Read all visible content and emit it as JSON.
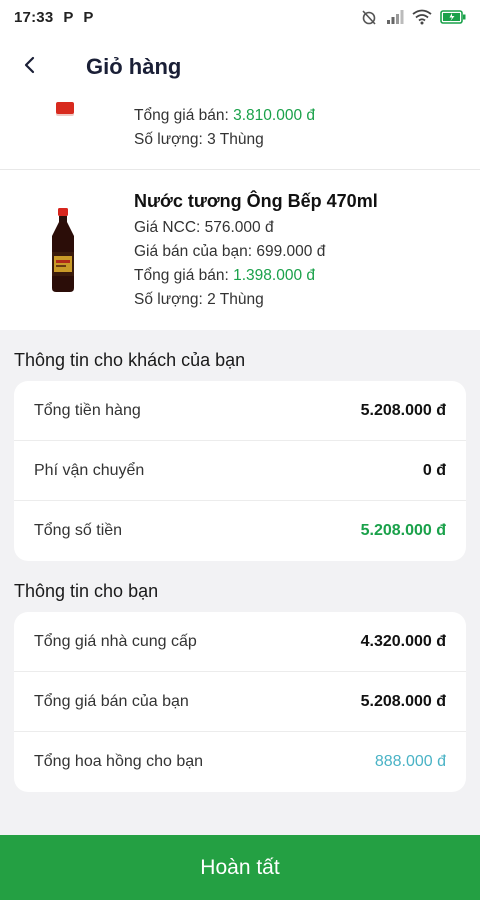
{
  "status_bar": {
    "time": "17:33",
    "app_icons": [
      "P",
      "P"
    ]
  },
  "header": {
    "title": "Giỏ hàng"
  },
  "products": [
    {
      "total_label": "Tổng giá bán: ",
      "total_value": "3.810.000 đ",
      "quantity": "Số lượng: 3 Thùng"
    },
    {
      "name": "Nước tương Ông Bếp 470ml",
      "supplier_price": "Giá NCC: 576.000 đ",
      "your_price": "Giá bán của bạn: 699.000 đ",
      "total_label": "Tổng giá bán: ",
      "total_value": "1.398.000 đ",
      "quantity": "Số lượng: 2 Thùng"
    }
  ],
  "customer_info": {
    "title": "Thông tin cho khách của bạn",
    "rows": [
      {
        "label": "Tổng tiền hàng",
        "value": "5.208.000 đ"
      },
      {
        "label": "Phí vận chuyển",
        "value": "0 đ"
      },
      {
        "label": "Tổng số tiền",
        "value": "5.208.000 đ"
      }
    ]
  },
  "your_info": {
    "title": "Thông tin cho bạn",
    "rows": [
      {
        "label": "Tổng giá nhà cung cấp",
        "value": "4.320.000 đ"
      },
      {
        "label": "Tổng giá bán của bạn",
        "value": "5.208.000 đ"
      },
      {
        "label": "Tổng hoa hồng cho bạn",
        "value": "888.000 đ"
      }
    ]
  },
  "footer": {
    "button_label": "Hoàn tất"
  },
  "colors": {
    "primary_green": "#24a043",
    "price_green": "#1aa14a",
    "commission_teal": "#4ab3c6"
  }
}
